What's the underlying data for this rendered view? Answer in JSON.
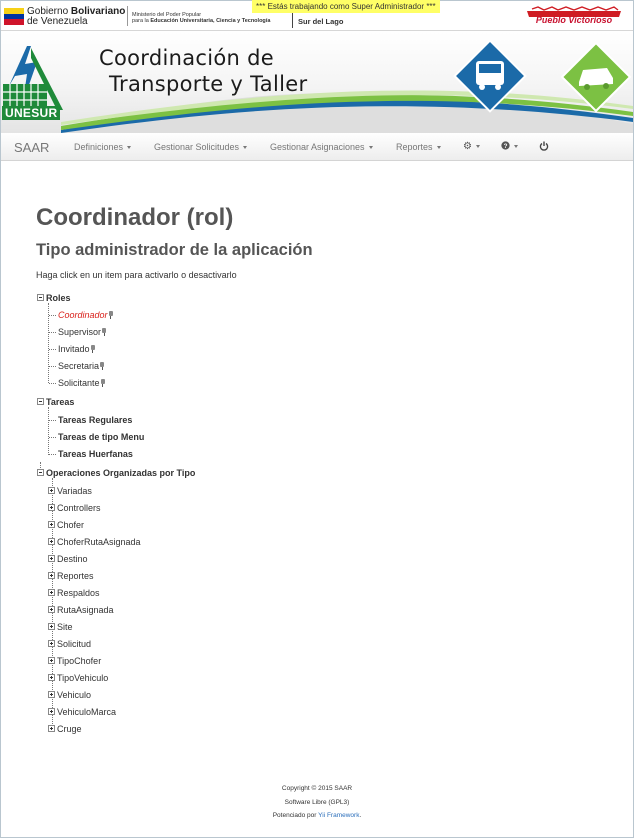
{
  "top_bar": {
    "gov_line1": "Gobierno",
    "gov_line1_bold": "Bolivariano",
    "gov_line2": "de Venezuela",
    "ministry_line1": "Ministerio del Poder Popular",
    "ministry_line2_prefix": "para la",
    "ministry_line2_bold": "Educación Universitaria, Ciencia y Tecnología",
    "region": "Sur del Lago",
    "admin_notice": "*** Estás trabajando como Super Administrador ***",
    "right_logo_text": "Pueblo Victorioso"
  },
  "banner": {
    "title_line1": "Coordinación de",
    "title_line2": "Transporte y Taller",
    "logo_text": "UNESUR"
  },
  "navbar": {
    "brand": "SAAR",
    "menus": [
      "Definiciones",
      "Gestionar Solicitudes",
      "Gestionar Asignaciones",
      "Reportes"
    ],
    "icons": [
      "gear-icon",
      "help-icon",
      "power-icon"
    ]
  },
  "content": {
    "title": "Coordinador (rol)",
    "subtitle": "Tipo administrador de la aplicación",
    "hint": "Haga click en un item para activarlo o desactivarlo"
  },
  "tree": {
    "roles": {
      "label": "Roles",
      "items": [
        {
          "label": "Coordinador",
          "active": true
        },
        {
          "label": "Supervisor",
          "active": false
        },
        {
          "label": "Invitado",
          "active": false
        },
        {
          "label": "Secretaria",
          "active": false
        },
        {
          "label": "Solicitante",
          "active": false
        }
      ]
    },
    "tareas": {
      "label": "Tareas",
      "items": [
        "Tareas Regulares",
        "Tareas de tipo Menu",
        "Tareas Huerfanas"
      ]
    },
    "operaciones": {
      "label": "Operaciones Organizadas por Tipo",
      "items": [
        "Variadas",
        "Controllers",
        "Chofer",
        "ChoferRutaAsignada",
        "Destino",
        "Reportes",
        "Respaldos",
        "RutaAsignada",
        "Site",
        "Solicitud",
        "TipoChofer",
        "TipoVehiculo",
        "Vehiculo",
        "VehiculoMarca",
        "Cruge"
      ]
    }
  },
  "footer": {
    "copyright": "Copyright © 2015 SAAR",
    "license": "Software Libre (GPL3)",
    "powered_prefix": "Potenciado por",
    "powered_link": "Yii Framework",
    "powered_suffix": "."
  },
  "colors": {
    "active_role": "#d9231d",
    "admin_banner": "#ffff66",
    "link": "#2a6ebb",
    "unesur_green": "#1f8a3a",
    "banner_blue": "#1b6aa8",
    "banner_green": "#7cc143"
  }
}
